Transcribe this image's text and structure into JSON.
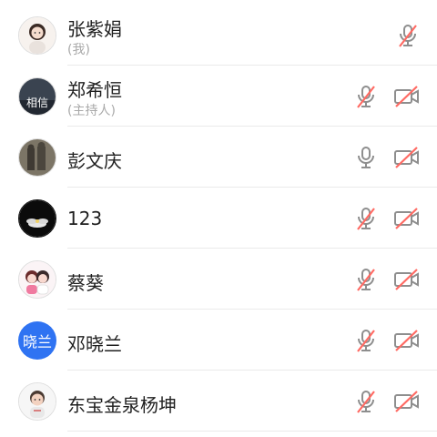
{
  "colors": {
    "accent_blue": "#2f73f2",
    "muted_red": "#ff6a63",
    "icon_gray": "#8e8e8e",
    "separator": "#eaeaea"
  },
  "participants": [
    {
      "name": "张紫娟",
      "note": "(我)",
      "avatar": "photo-girl-illustration",
      "mic": "muted",
      "camera": "none"
    },
    {
      "name": "郑希恒",
      "note": "(主持人)",
      "avatar": "photo-text-相信",
      "avatar_text": "相信",
      "mic": "muted",
      "camera": "off"
    },
    {
      "name": "彭文庆",
      "note": "",
      "avatar": "photo-statues",
      "mic": "on",
      "camera": "off"
    },
    {
      "name": "123",
      "note": "",
      "avatar": "photo-flower-dark",
      "mic": "muted",
      "camera": "off"
    },
    {
      "name": "蔡葵",
      "note": "",
      "avatar": "photo-cartoon-couple",
      "mic": "muted",
      "camera": "off"
    },
    {
      "name": "邓晓兰",
      "note": "",
      "avatar": "text",
      "avatar_text": "晓兰",
      "mic": "muted",
      "camera": "off"
    },
    {
      "name": "东宝金泉杨坤",
      "note": "",
      "avatar": "photo-cartoon-boy",
      "mic": "muted",
      "camera": "off"
    }
  ]
}
